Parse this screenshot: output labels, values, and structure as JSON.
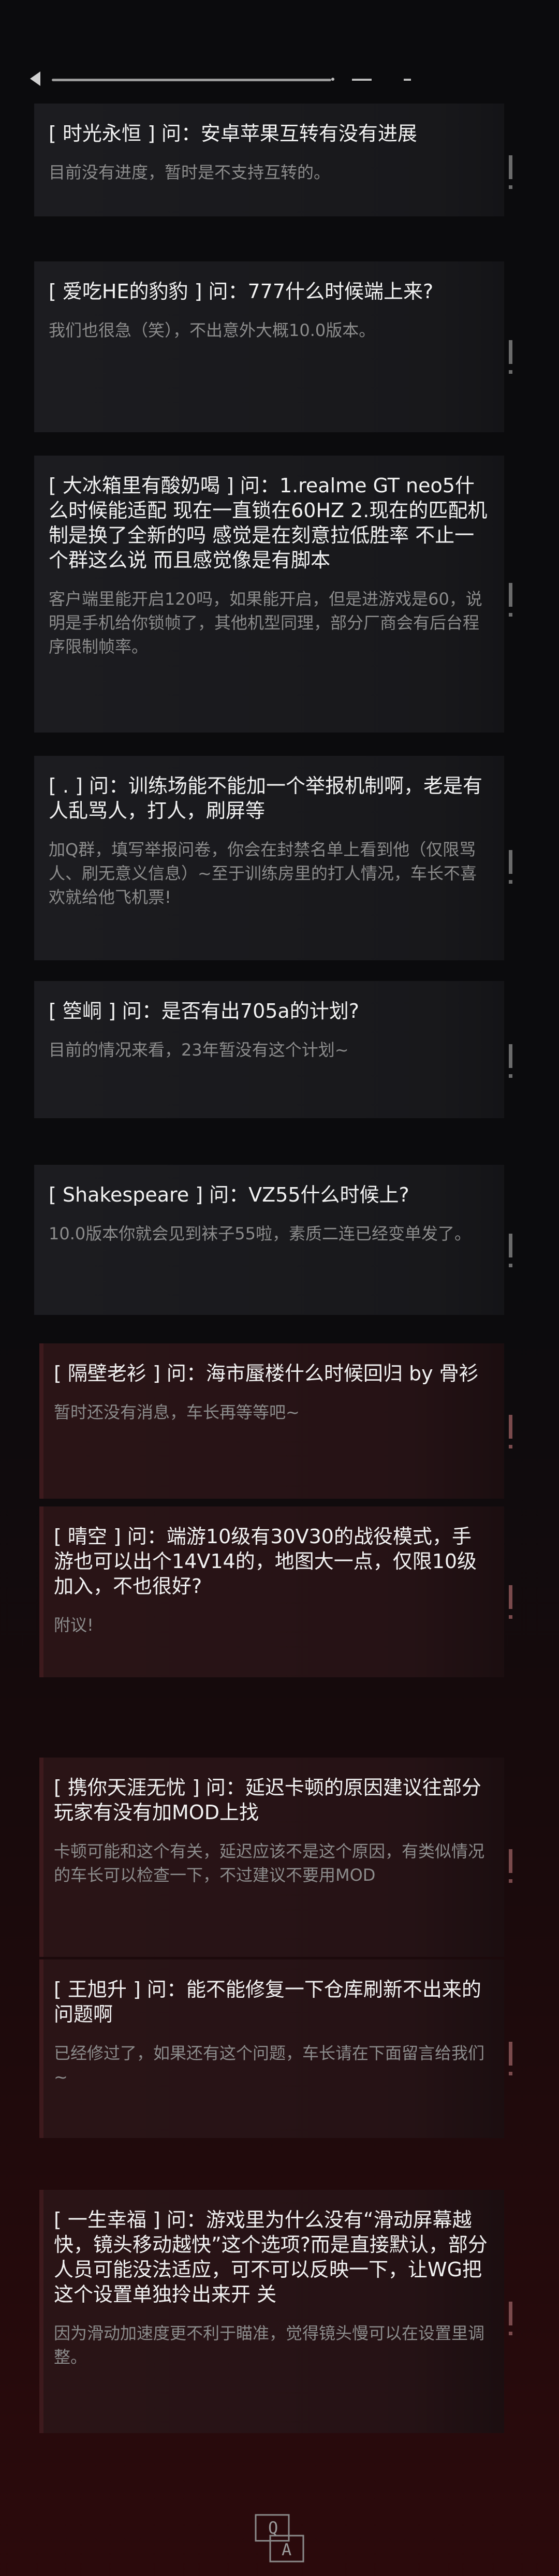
{
  "items": [
    {
      "q": "[ 时光永恒 ] 问：安卓苹果互转有没有进展",
      "a": "目前没有进度，暂时是不支持互转的。"
    },
    {
      "q": "[ 爱吃HE的豹豹 ] 问：777什么时候端上来?",
      "a": "我们也很急（笑），不出意外大概10.0版本。"
    },
    {
      "q": "[ 大冰箱里有酸奶喝 ] 问：1.realme GT neo5什么时候能适配 现在一直锁在60HZ 2.现在的匹配机制是换了全新的吗 感觉是在刻意拉低胜率 不止一个群这么说 而且感觉像是有脚本",
      "a": "客户端里能开启120吗，如果能开启，但是进游戏是60，说明是手机给你锁帧了，其他机型同理，部分厂商会有后台程序限制帧率。"
    },
    {
      "q": "[ . ] 问：训练场能不能加一个举报机制啊，老是有人乱骂人，打人，刷屏等",
      "a": "加Q群，填写举报问卷，你会在封禁名单上看到他（仅限骂人、刷无意义信息）~至于训练房里的打人情况，车长不喜欢就给他飞机票!"
    },
    {
      "q": "[ 箜峒 ] 问：是否有出705a的计划?",
      "a": "目前的情况来看，23年暂没有这个计划~"
    },
    {
      "q": "[ Shakespeare ] 问：VZ55什么时候上?",
      "a": "10.0版本你就会见到袜子55啦，素质二连已经变单发了。"
    },
    {
      "q": "[ 隔壁老衫 ] 问：海市蜃楼什么时候回归 by 骨衫",
      "a": "暂时还没有消息，车长再等等吧~"
    },
    {
      "q": "[ 晴空 ] 问：端游10级有30V30的战役模式，手游也可以出个14V14的，地图大一点，仅限10级加入，不也很好?",
      "a": "附议!"
    },
    {
      "q": "[ 携你天涯无忧 ] 问：延迟卡顿的原因建议往部分玩家有没有加MOD上找",
      "a": "卡顿可能和这个有关，延迟应该不是这个原因，有类似情况的车长可以检查一下，不过建议不要用MOD"
    },
    {
      "q": "[ 王旭升 ] 问：能不能修复一下仓库刷新不出来的问题啊",
      "a": "已经修过了，如果还有这个问题，车长请在下面留言给我们~"
    },
    {
      "q": "[ 一生幸福 ] 问：游戏里为什么没有“滑动屏幕越快，镜头移动越快”这个选项?而是直接默认，部分人员可能没法适应，可不可以反映一下，让WG把这个设置单独拎出来开 关",
      "a": "因为滑动加速度更不利于瞄准，觉得镜头慢可以在设置里调整。"
    }
  ],
  "logo": {
    "top": "Q",
    "bottom": "A"
  },
  "colors": {
    "background": "#0b0b0d",
    "card": "#1c1c20",
    "card_red": "#2a1416",
    "answer": "#8c8c8c"
  }
}
